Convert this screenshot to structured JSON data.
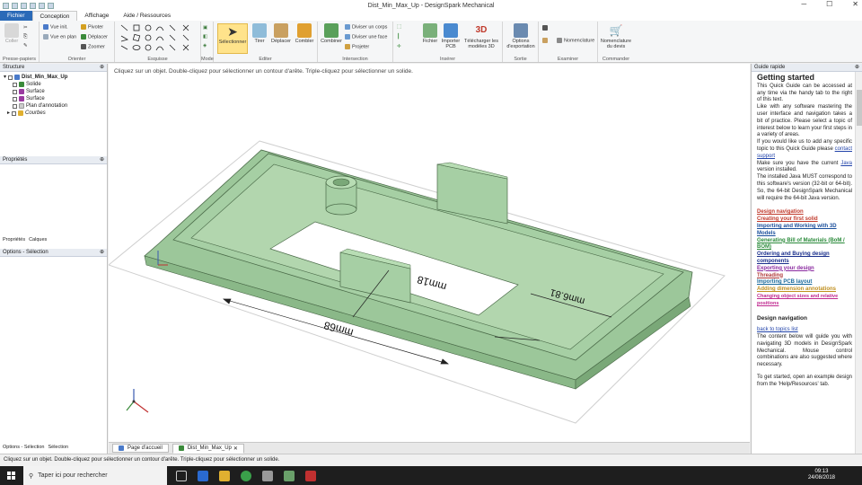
{
  "window": {
    "title": "Dist_Min_Max_Up - DesignSpark Mechanical"
  },
  "tabs": [
    "Fichier",
    "Conception",
    "Affichage",
    "Aide / Ressources"
  ],
  "ribbon": {
    "presse_papiers": {
      "label": "Presse-papiers",
      "coller": "Coller"
    },
    "orienter": {
      "label": "Orienter",
      "items": [
        "Vue init.",
        "Vue en plan",
        "Pivoter",
        "Déplacer",
        "Zoomer"
      ]
    },
    "esquisse": {
      "label": "Esquisse"
    },
    "mode": {
      "label": "Mode",
      "selectionner": "Sélectionner"
    },
    "editer": {
      "label": "Editer",
      "items": [
        "Tirer",
        "Déplacer",
        "Combler"
      ]
    },
    "intersection": {
      "label": "Intersection",
      "combiner": "Combiner",
      "items": [
        "Diviser un corps",
        "Diviser une face",
        "Projeter"
      ]
    },
    "inserer": {
      "label": "Insérer",
      "fichier": "Fichier",
      "importer": "Importer PCB",
      "telecharger": "Télécharger les modèles 3D"
    },
    "sortie": {
      "label": "Sortie",
      "options": "Options d'exportation"
    },
    "examiner": {
      "label": "Examiner",
      "nomenclature": "Nomenclature"
    },
    "commander": {
      "label": "Commander",
      "devis": "Nomenclature du devis"
    }
  },
  "structure": {
    "title": "Structure",
    "root": "Dist_Min_Max_Up",
    "items": [
      "Solide",
      "Surface",
      "Surface",
      "Plan d'annotation",
      "Courbes"
    ]
  },
  "proprietes": {
    "title": "Propriétés",
    "tabs": [
      "Propriétés",
      "Calques"
    ]
  },
  "options_selection": {
    "title": "Options - Sélection",
    "tabs": [
      "Options - Sélection",
      "Sélection"
    ]
  },
  "viewport": {
    "hint": "Cliquez sur un objet. Double-cliquez pour sélectionner un contour d'arête. Triple-cliquez pour sélectionner un solide.",
    "dims": [
      "mm18",
      "mm68",
      "mm6.81"
    ]
  },
  "doc_tabs": [
    "Page d'accueil",
    "Dist_Min_Max_Up"
  ],
  "guide": {
    "header": "Guide rapide",
    "title": "Getting started",
    "p1": "This Quick Guide can be accessed at any time via the handy tab to the right of this text.",
    "p2": "Like with any software mastering the user interface and navigation takes a bit of practice. Please select a topic of interest below to learn your first steps in a variety of areas.",
    "p3a": "If you would like us to add any specific topic to this Quick Guide please",
    "p3link": "contact support",
    "p4a": "Make sure you have the current",
    "p4link": "Java",
    "p4b": "version installed.",
    "p5": "The installed Java MUST correspond to this software's version (32-bit or 64-bit). So, the 64-bit DesignSpark Mechanical will require the 64-bit Java version.",
    "topics": [
      "Design navigation",
      "Creating your first solid",
      "Importing and Working with 3D Models",
      "Generating Bill of Materials (BoM / BOM)",
      "Ordering and Buying design components",
      "Exporting your design",
      "Threading",
      "Importing PCB layout",
      "Adding dimension annotations",
      "Changing object sizes and relative positions"
    ],
    "topic_colors": [
      "#c0392b",
      "#c0392b",
      "#1a4f9c",
      "#2a8a3a",
      "#1a2f8c",
      "#8a2aa0",
      "#b03a3a",
      "#1a6a9c",
      "#c09020",
      "#c02a90"
    ],
    "section": "Design navigation",
    "back": "back to topics list",
    "p6": "The content below will guide you with navigating 3D models in DesignSpark Mechanical. Mouse control combinations are also suggested where necessary.",
    "p7": "To get started, open an example design from the 'Help/Resources' tab."
  },
  "status": "Cliquez sur un objet. Double-cliquez pour sélectionner un contour d'arête. Triple-cliquez pour sélectionner un solide.",
  "taskbar": {
    "search": "Taper ici pour rechercher",
    "time": "09:13",
    "date": "24/08/2018"
  }
}
